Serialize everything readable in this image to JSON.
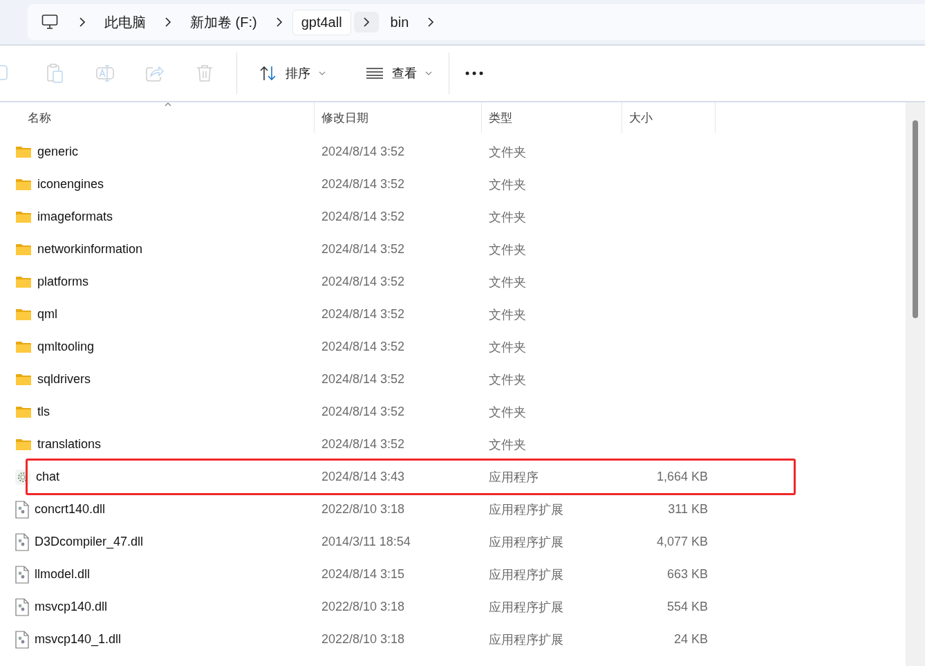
{
  "breadcrumb": [
    {
      "label": "此电脑",
      "selected": false
    },
    {
      "label": "新加卷 (F:)",
      "selected": false
    },
    {
      "label": "gpt4all",
      "selected": true
    },
    {
      "label": "bin",
      "selected": false
    }
  ],
  "toolbar": [
    {
      "kind": "copy",
      "disabled": true
    },
    {
      "kind": "paste",
      "disabled": true
    },
    {
      "kind": "rename",
      "disabled": true
    },
    {
      "kind": "share",
      "disabled": true
    },
    {
      "kind": "delete",
      "disabled": true
    },
    {
      "kind": "sort",
      "label": "排序",
      "disabled": false
    },
    {
      "kind": "view",
      "label": "查看",
      "disabled": false
    },
    {
      "kind": "more",
      "disabled": false
    }
  ],
  "table": {
    "columns": [
      {
        "label": "名称",
        "sorted": true
      },
      {
        "label": "修改日期",
        "sorted": false
      },
      {
        "label": "类型",
        "sorted": false
      },
      {
        "label": "大小",
        "sorted": false
      }
    ],
    "rows": [
      {
        "kind": "folder",
        "name": "generic",
        "date": "2024/8/14 3:52",
        "type": "文件夹",
        "highlighted": false
      },
      {
        "kind": "folder",
        "name": "iconengines",
        "date": "2024/8/14 3:52",
        "type": "文件夹",
        "highlighted": false
      },
      {
        "kind": "folder",
        "name": "imageformats",
        "date": "2024/8/14 3:52",
        "type": "文件夹",
        "highlighted": false
      },
      {
        "kind": "folder",
        "name": "networkinformation",
        "date": "2024/8/14 3:52",
        "type": "文件夹",
        "highlighted": false
      },
      {
        "kind": "folder",
        "name": "platforms",
        "date": "2024/8/14 3:52",
        "type": "文件夹",
        "highlighted": false
      },
      {
        "kind": "folder",
        "name": "qml",
        "date": "2024/8/14 3:52",
        "type": "文件夹",
        "highlighted": false
      },
      {
        "kind": "folder",
        "name": "qmltooling",
        "date": "2024/8/14 3:52",
        "type": "文件夹",
        "highlighted": false
      },
      {
        "kind": "folder",
        "name": "sqldrivers",
        "date": "2024/8/14 3:52",
        "type": "文件夹",
        "highlighted": false
      },
      {
        "kind": "folder",
        "name": "tls",
        "date": "2024/8/14 3:52",
        "type": "文件夹",
        "highlighted": false
      },
      {
        "kind": "folder",
        "name": "translations",
        "date": "2024/8/14 3:52",
        "type": "文件夹",
        "highlighted": false
      },
      {
        "kind": "app",
        "name": "chat",
        "date": "2024/8/14 3:43",
        "type": "应用程序",
        "size": "1,664 KB",
        "highlighted": true
      },
      {
        "kind": "dll",
        "name": "concrt140.dll",
        "date": "2022/8/10 3:18",
        "type": "应用程序扩展",
        "size": "311 KB",
        "highlighted": false
      },
      {
        "kind": "dll",
        "name": "D3Dcompiler_47.dll",
        "date": "2014/3/11 18:54",
        "type": "应用程序扩展",
        "size": "4,077 KB",
        "highlighted": false
      },
      {
        "kind": "dll",
        "name": "llmodel.dll",
        "date": "2024/8/14 3:15",
        "type": "应用程序扩展",
        "size": "663 KB",
        "highlighted": false
      },
      {
        "kind": "dll",
        "name": "msvcp140.dll",
        "date": "2022/8/10 3:18",
        "type": "应用程序扩展",
        "size": "554 KB",
        "highlighted": false
      },
      {
        "kind": "dll",
        "name": "msvcp140_1.dll",
        "date": "2022/8/10 3:18",
        "type": "应用程序扩展",
        "size": "24 KB",
        "highlighted": false
      }
    ]
  }
}
